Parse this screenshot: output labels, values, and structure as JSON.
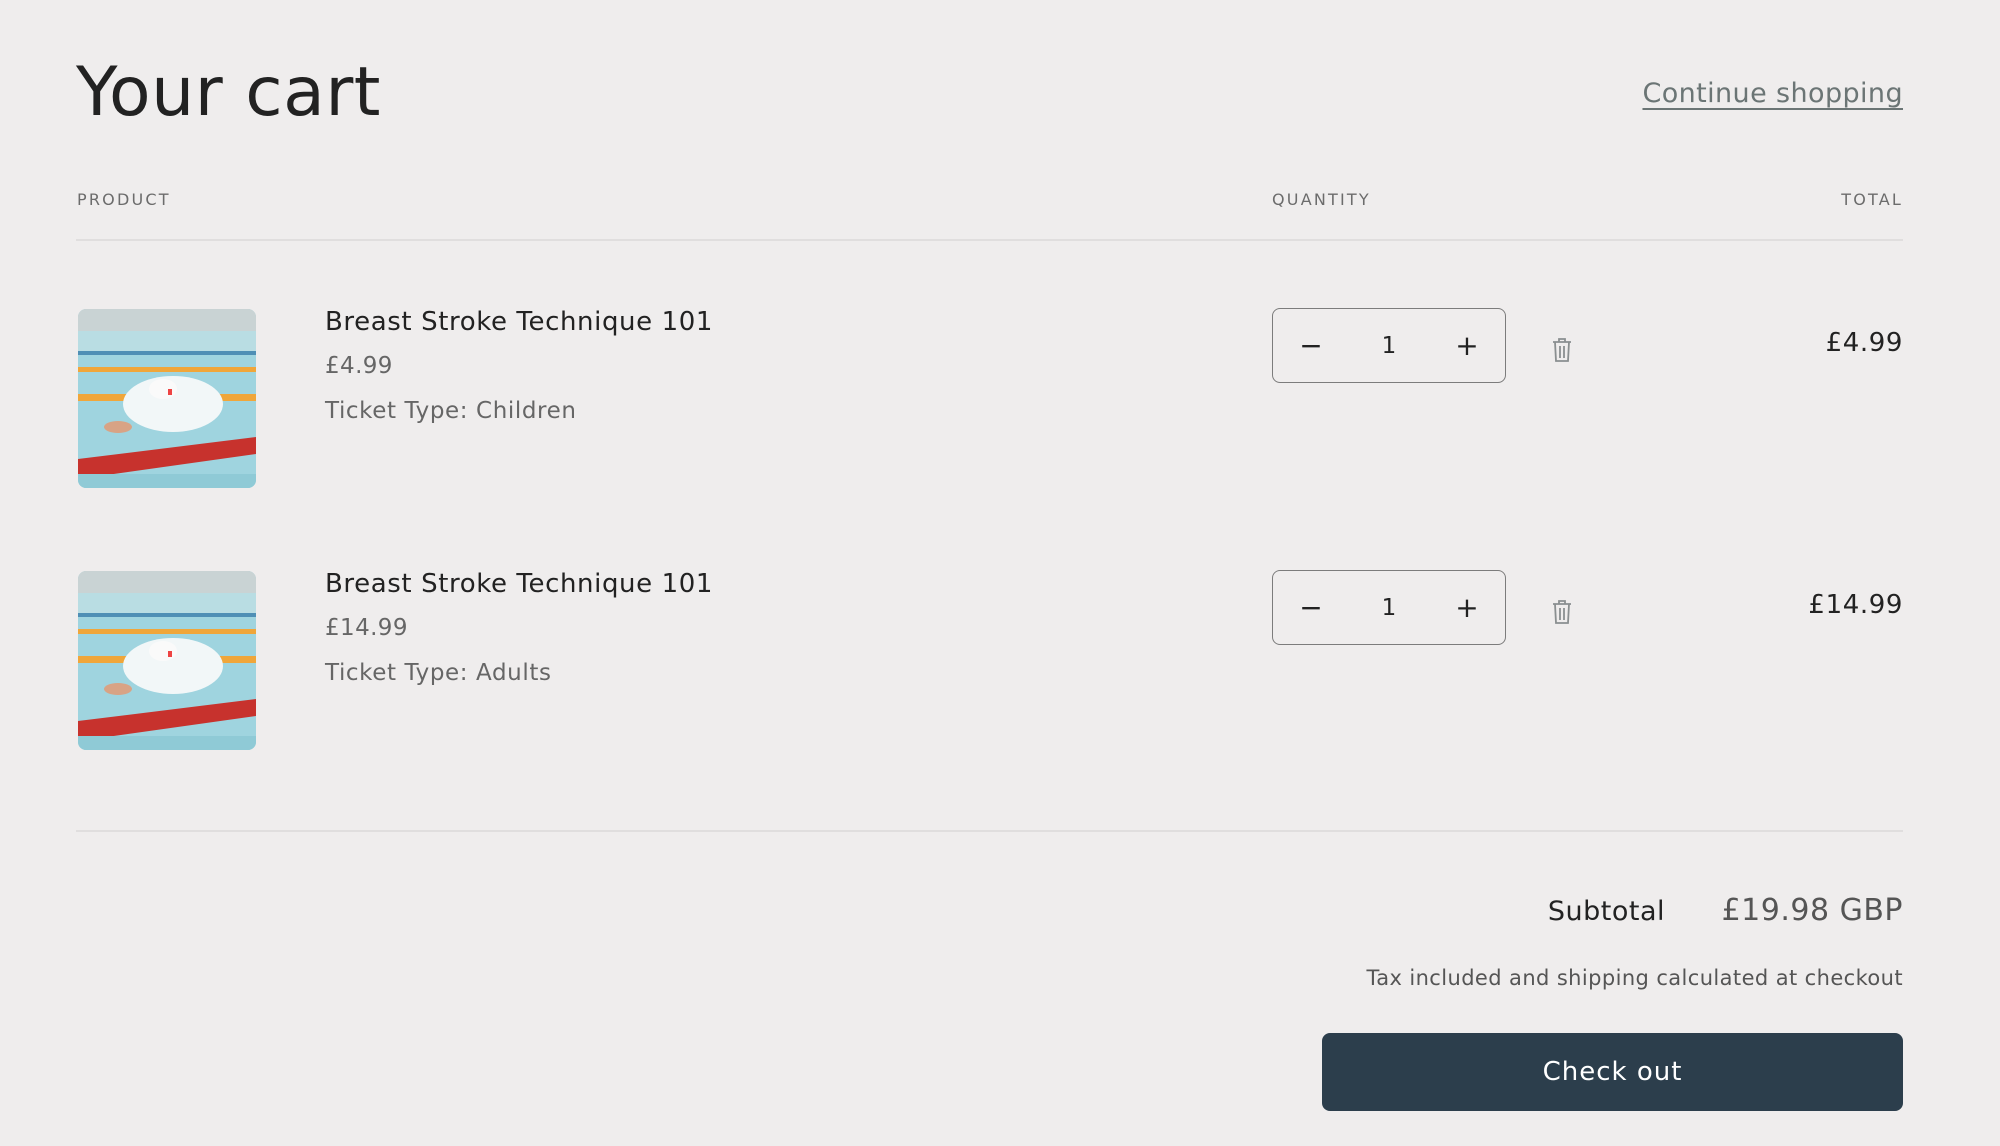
{
  "header": {
    "title": "Your cart",
    "continue_shopping": "Continue shopping"
  },
  "columns": {
    "product": "PRODUCT",
    "quantity": "QUANTITY",
    "total": "TOTAL"
  },
  "items": [
    {
      "name": "Breast Stroke Technique 101",
      "price": "£4.99",
      "option": "Ticket Type: Children",
      "quantity": "1",
      "decrease": "−",
      "increase": "+",
      "line_total": "£4.99",
      "image_icon": "swimmer-photo",
      "remove_icon": "trash-icon"
    },
    {
      "name": "Breast Stroke Technique 101",
      "price": "£14.99",
      "option": "Ticket Type: Adults",
      "quantity": "1",
      "decrease": "−",
      "increase": "+",
      "line_total": "£14.99",
      "image_icon": "swimmer-photo",
      "remove_icon": "trash-icon"
    }
  ],
  "summary": {
    "subtotal_label": "Subtotal",
    "subtotal_value": "£19.98 GBP",
    "tax_note": "Tax included and shipping calculated at checkout",
    "checkout_label": "Check out"
  },
  "colors": {
    "background": "#efeded",
    "checkout_button": "#2c3e4c",
    "link": "#6b7575"
  }
}
